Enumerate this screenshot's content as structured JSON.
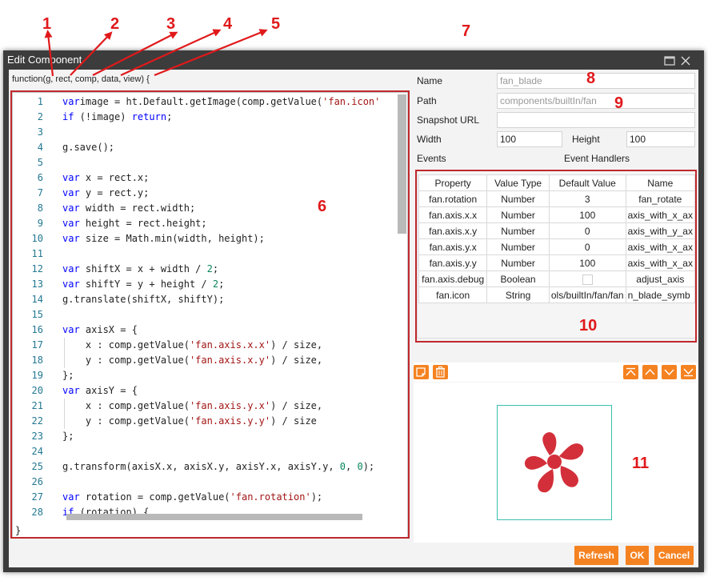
{
  "callouts": [
    "1",
    "2",
    "3",
    "4",
    "5",
    "6",
    "7",
    "8",
    "9",
    "10",
    "11"
  ],
  "dialog": {
    "title": "Edit Component",
    "signature": "function(g, rect, comp, data, view) {",
    "closing_brace": "}"
  },
  "editor": {
    "lines": [
      {
        "n": "1",
        "t": [
          [
            "kw",
            "var"
          ],
          [
            "",
            "image = ht.Default.getImage(comp.getValue("
          ],
          [
            "str",
            "'fan.icon'"
          ]
        ]
      },
      {
        "n": "2",
        "t": [
          [
            "kw",
            "if"
          ],
          [
            "",
            " (!image) "
          ],
          [
            "kw",
            "return"
          ],
          [
            "",
            ";"
          ]
        ]
      },
      {
        "n": "3",
        "t": []
      },
      {
        "n": "4",
        "t": [
          [
            "",
            "g.save();"
          ]
        ]
      },
      {
        "n": "5",
        "t": []
      },
      {
        "n": "6",
        "t": [
          [
            "kw",
            "var"
          ],
          [
            "",
            " x = rect.x;"
          ]
        ]
      },
      {
        "n": "7",
        "t": [
          [
            "kw",
            "var"
          ],
          [
            "",
            " y = rect.y;"
          ]
        ]
      },
      {
        "n": "8",
        "t": [
          [
            "kw",
            "var"
          ],
          [
            "",
            " width = rect.width;"
          ]
        ]
      },
      {
        "n": "9",
        "t": [
          [
            "kw",
            "var"
          ],
          [
            "",
            " height = rect.height;"
          ]
        ]
      },
      {
        "n": "10",
        "t": [
          [
            "kw",
            "var"
          ],
          [
            "",
            " size = Math.min(width, height);"
          ]
        ]
      },
      {
        "n": "11",
        "t": []
      },
      {
        "n": "12",
        "t": [
          [
            "kw",
            "var"
          ],
          [
            "",
            " shiftX = x + width / "
          ],
          [
            "num",
            "2"
          ],
          [
            "",
            ";"
          ]
        ]
      },
      {
        "n": "13",
        "t": [
          [
            "kw",
            "var"
          ],
          [
            "",
            " shiftY = y + height / "
          ],
          [
            "num",
            "2"
          ],
          [
            "",
            ";"
          ]
        ]
      },
      {
        "n": "14",
        "t": [
          [
            "",
            "g.translate(shiftX, shiftY);"
          ]
        ]
      },
      {
        "n": "15",
        "t": []
      },
      {
        "n": "16",
        "t": [
          [
            "kw",
            "var"
          ],
          [
            "",
            " axisX = {"
          ]
        ]
      },
      {
        "n": "17",
        "t": [
          [
            "",
            "    x : comp.getValue("
          ],
          [
            "str",
            "'fan.axis.x.x'"
          ],
          [
            "",
            ") / size,"
          ]
        ]
      },
      {
        "n": "18",
        "t": [
          [
            "",
            "    y : comp.getValue("
          ],
          [
            "str",
            "'fan.axis.x.y'"
          ],
          [
            "",
            ") / size,"
          ]
        ]
      },
      {
        "n": "19",
        "t": [
          [
            "",
            "};"
          ]
        ]
      },
      {
        "n": "20",
        "t": [
          [
            "kw",
            "var"
          ],
          [
            "",
            " axisY = {"
          ]
        ]
      },
      {
        "n": "21",
        "t": [
          [
            "",
            "    x : comp.getValue("
          ],
          [
            "str",
            "'fan.axis.y.x'"
          ],
          [
            "",
            ") / size,"
          ]
        ]
      },
      {
        "n": "22",
        "t": [
          [
            "",
            "    y : comp.getValue("
          ],
          [
            "str",
            "'fan.axis.y.y'"
          ],
          [
            "",
            ") / size"
          ]
        ]
      },
      {
        "n": "23",
        "t": [
          [
            "",
            "};"
          ]
        ]
      },
      {
        "n": "24",
        "t": []
      },
      {
        "n": "25",
        "t": [
          [
            "",
            "g.transform(axisX.x, axisX.y, axisY.x, axisY.y, "
          ],
          [
            "num",
            "0"
          ],
          [
            "",
            ", "
          ],
          [
            "num",
            "0"
          ],
          [
            "",
            ");"
          ]
        ]
      },
      {
        "n": "26",
        "t": []
      },
      {
        "n": "27",
        "t": [
          [
            "kw",
            "var"
          ],
          [
            "",
            " rotation = comp.getValue("
          ],
          [
            "str",
            "'fan.rotation'"
          ],
          [
            "",
            ");"
          ]
        ]
      },
      {
        "n": "28",
        "t": [
          [
            "kw",
            "if"
          ],
          [
            "",
            " (rotation) {"
          ]
        ]
      }
    ]
  },
  "props": {
    "name_label": "Name",
    "name_value": "fan_blade",
    "path_label": "Path",
    "path_value": "components/builtIn/fan",
    "snapshot_label": "Snapshot URL",
    "snapshot_value": "",
    "width_label": "Width",
    "width_value": "100",
    "height_label": "Height",
    "height_value": "100",
    "events_label": "Events",
    "handlers_label": "Event Handlers"
  },
  "table": {
    "headers": [
      "Property",
      "Value Type",
      "Default Value",
      "Name"
    ],
    "rows": [
      [
        "fan.rotation",
        "Number",
        "3",
        "fan_rotate"
      ],
      [
        "fan.axis.x.x",
        "Number",
        "100",
        "axis_with_x_ax"
      ],
      [
        "fan.axis.x.y",
        "Number",
        "0",
        "axis_with_y_ax"
      ],
      [
        "fan.axis.y.x",
        "Number",
        "0",
        "axis_with_x_ax"
      ],
      [
        "fan.axis.y.y",
        "Number",
        "100",
        "axis_with_x_ax"
      ],
      [
        "fan.axis.debug",
        "Boolean",
        "",
        "adjust_axis"
      ],
      [
        "fan.icon",
        "String",
        "ols/builtIn/fan/fan",
        "n_blade_symb"
      ]
    ]
  },
  "footer": {
    "refresh": "Refresh",
    "ok": "OK",
    "cancel": "Cancel"
  },
  "colors": {
    "accent": "#f58220",
    "callout": "#e0191b",
    "titlebar": "#3c3c3c",
    "fan": "#d32f3a",
    "preview_border": "#3cbfae"
  }
}
